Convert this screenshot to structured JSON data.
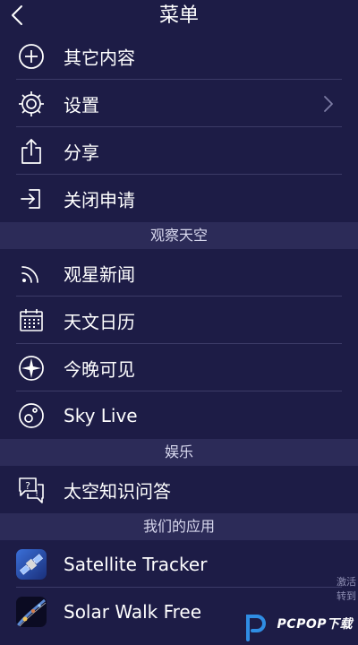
{
  "header": {
    "title": "菜单"
  },
  "menu": {
    "items": [
      {
        "label": "其它内容"
      },
      {
        "label": "设置"
      },
      {
        "label": "分享"
      },
      {
        "label": "关闭申请"
      }
    ]
  },
  "observe": {
    "section_title": "观察天空",
    "items": [
      {
        "label": "观星新闻"
      },
      {
        "label": "天文日历"
      },
      {
        "label": "今晚可见"
      },
      {
        "label": "Sky Live"
      }
    ]
  },
  "entertainment": {
    "section_title": "娱乐",
    "items": [
      {
        "label": "太空知识问答"
      }
    ]
  },
  "apps": {
    "section_title": "我们的应用",
    "items": [
      {
        "label": "Satellite Tracker"
      },
      {
        "label": "Solar Walk Free"
      }
    ]
  },
  "watermark": {
    "side_line1": "激活",
    "side_line2": "转到",
    "brand": "PCPOP下载"
  },
  "colors": {
    "background": "#1d1c46",
    "section_bg": "#2c2b58",
    "separator": "#3c3b67",
    "text": "#ffffff"
  }
}
